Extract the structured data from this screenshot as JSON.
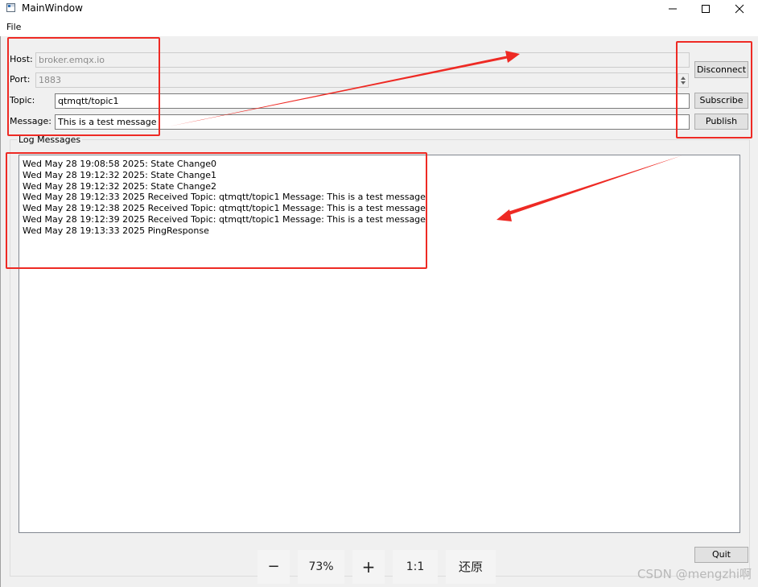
{
  "window": {
    "title": "MainWindow",
    "app_icon": "window-app-icon",
    "controls": [
      "minimize-icon",
      "maximize-icon",
      "close-icon"
    ]
  },
  "menubar": {
    "items": [
      {
        "label": "File"
      }
    ]
  },
  "connection": {
    "host_label": "Host:",
    "host_value": "broker.emqx.io",
    "port_label": "Port:",
    "port_value": "1883",
    "topic_label": "Topic:",
    "topic_value": "qtmqtt/topic1",
    "message_label": "Message:",
    "message_value": "This is a test message"
  },
  "buttons": {
    "disconnect": "Disconnect",
    "subscribe": "Subscribe",
    "publish": "Publish",
    "quit": "Quit"
  },
  "log": {
    "group_title": "Log Messages",
    "lines": [
      "Wed May 28 19:08:58 2025: State Change0",
      "Wed May 28 19:12:32 2025: State Change1",
      "Wed May 28 19:12:32 2025: State Change2",
      "Wed May 28 19:12:33 2025 Received Topic: qtmqtt/topic1 Message: This is a test message",
      "Wed May 28 19:12:38 2025 Received Topic: qtmqtt/topic1 Message: This is a test message",
      "Wed May 28 19:12:39 2025 Received Topic: qtmqtt/topic1 Message: This is a test message",
      "Wed May 28 19:13:33 2025 PingResponse"
    ]
  },
  "zoom": {
    "minus": "−",
    "level": "73%",
    "plus": "+",
    "actual": "1:1",
    "restore": "还原"
  },
  "watermark": "CSDN @mengzhi啊",
  "colors": {
    "annotation_red": "#ee2a24",
    "window_bg": "#f0f0f0"
  }
}
